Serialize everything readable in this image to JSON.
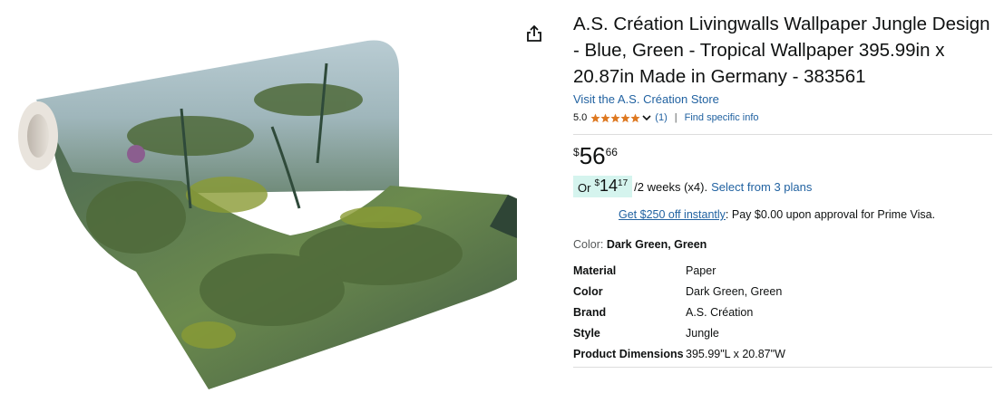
{
  "product": {
    "title": "A.S. Création Livingwalls Wallpaper Jungle Design - Blue, Green - Tropical Wallpaper 395.99in x 20.87in Made in Germany - 383561",
    "store_link": "Visit the A.S. Création Store",
    "image_alt": "wallpaper-roll-jungle-image"
  },
  "rating": {
    "value": "5.0",
    "stars": 5,
    "count": "(1)",
    "separator": "|",
    "find_info": "Find specific info"
  },
  "price": {
    "symbol": "$",
    "whole": "56",
    "fraction": "66"
  },
  "installment": {
    "prefix": "Or",
    "symbol": "$",
    "whole": "14",
    "fraction": "17",
    "term": "/2 weeks (x4).",
    "plans_link": "Select from 3 plans"
  },
  "promo": {
    "link": "Get $250 off instantly",
    "text": ": Pay $0.00 upon approval for Prime Visa."
  },
  "color": {
    "label": "Color:",
    "value": "Dark Green, Green"
  },
  "specs": [
    {
      "key": "Material",
      "value": "Paper"
    },
    {
      "key": "Color",
      "value": "Dark Green, Green"
    },
    {
      "key": "Brand",
      "value": "A.S. Création"
    },
    {
      "key": "Style",
      "value": "Jungle"
    },
    {
      "key": "Product Dimensions",
      "value": "395.99\"L x 20.87\"W"
    }
  ],
  "colors": {
    "link": "#2162a1",
    "star": "#de7921",
    "installment_bg": "#d5f4ee"
  },
  "icons": {
    "share": "share-icon",
    "star": "star-icon",
    "chevron": "chevron-down-icon"
  }
}
